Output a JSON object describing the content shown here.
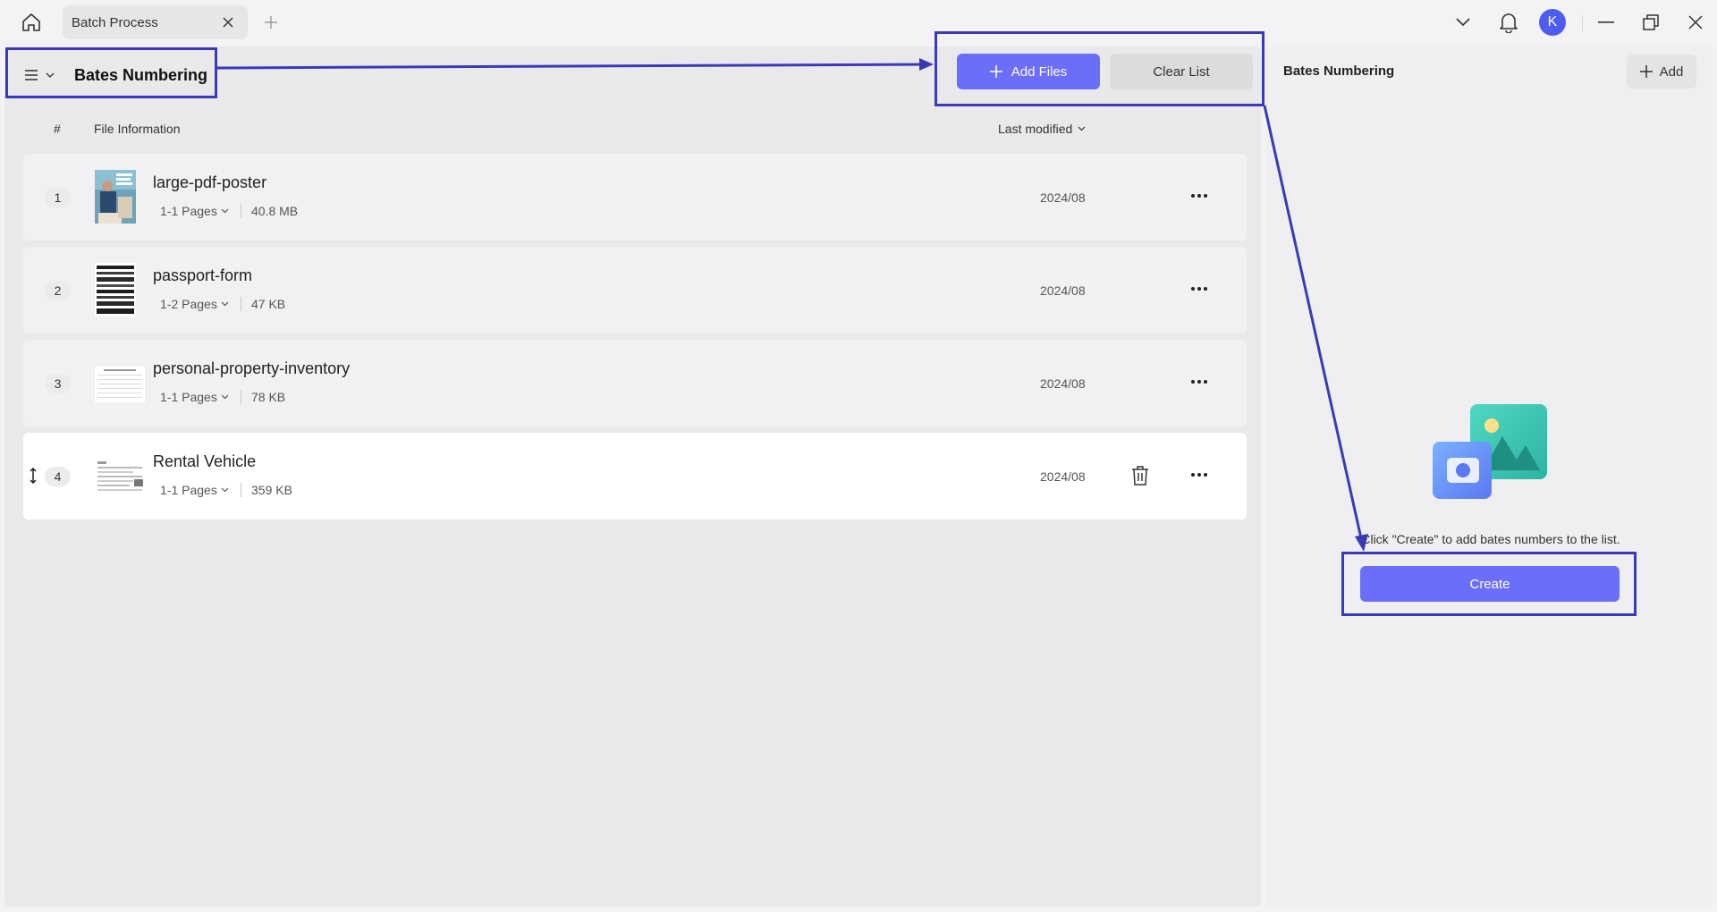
{
  "titlebar": {
    "tab_label": "Batch Process",
    "avatar_letter": "K",
    "icons": [
      "home-icon",
      "close-icon",
      "plus-icon",
      "chevron-down-icon",
      "bell-icon",
      "minimize-icon",
      "restore-icon",
      "window-close-icon"
    ]
  },
  "main": {
    "section_title": "Bates Numbering",
    "add_files_label": "Add Files",
    "clear_list_label": "Clear List",
    "columns": {
      "hash": "#",
      "info": "File Information",
      "modified": "Last modified"
    },
    "files": [
      {
        "num": "1",
        "name": "large-pdf-poster",
        "pages": "1-1 Pages",
        "size": "40.8 MB",
        "date": "2024/08"
      },
      {
        "num": "2",
        "name": "passport-form",
        "pages": "1-2 Pages",
        "size": "47 KB",
        "date": "2024/08"
      },
      {
        "num": "3",
        "name": "personal-property-inventory",
        "pages": "1-1 Pages",
        "size": "78 KB",
        "date": "2024/08"
      },
      {
        "num": "4",
        "name": "Rental Vehicle",
        "pages": "1-1 Pages",
        "size": "359 KB",
        "date": "2024/08"
      }
    ]
  },
  "side": {
    "title": "Bates Numbering",
    "add_label": "Add",
    "hint": "Click \"Create\" to add bates numbers to the list.",
    "create_label": "Create"
  },
  "colors": {
    "accent": "#6b6ef8",
    "annotation": "#3a3ab8",
    "avatar": "#4e5cf0"
  }
}
